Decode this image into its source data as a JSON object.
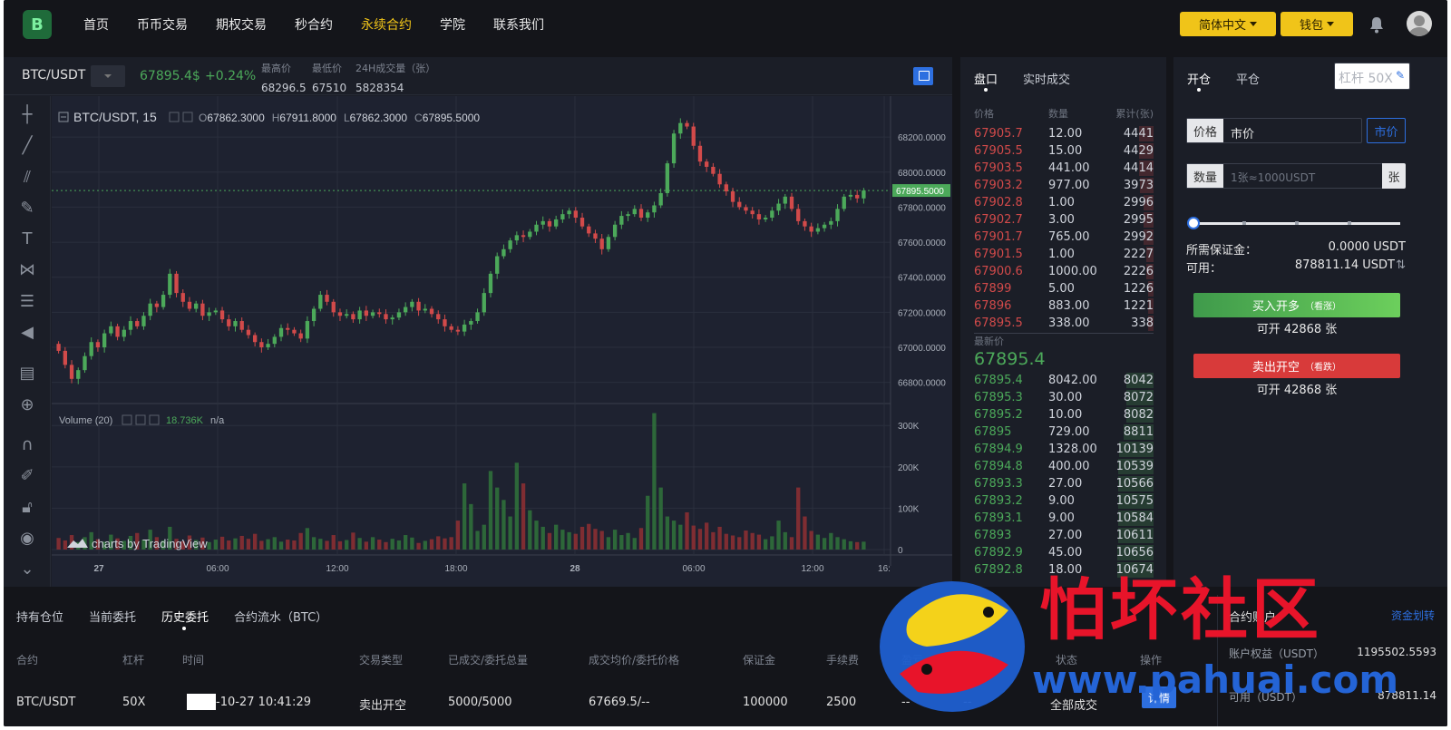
{
  "nav": {
    "logo": "B",
    "items": [
      "首页",
      "币币交易",
      "期权交易",
      "秒合约",
      "永续合约",
      "学院",
      "联系我们"
    ],
    "active_index": 4,
    "lang_label": "简体中文",
    "wallet_label": "钱包"
  },
  "ticker": {
    "pair": "BTC/USDT",
    "price": "67895.4$",
    "change": "+0.24%",
    "high_label": "最高价",
    "high": "68296.5",
    "low_label": "最低价",
    "low": "67510",
    "vol_label": "24H成交量（张）",
    "vol": "5828354"
  },
  "chart": {
    "legend_pair": "BTC/USDT, 15",
    "o": "67862.3000",
    "h": "67911.8000",
    "l": "67862.3000",
    "c": "67895.5000",
    "price_tag": "67895.5000",
    "volume_label": "Volume (20)",
    "volume_value": "18.736K",
    "volume_na": "n/a",
    "credit": "charts by TradingView",
    "y_ticks": [
      "68200.0000",
      "68000.0000",
      "67800.0000",
      "67600.0000",
      "67400.0000",
      "67200.0000",
      "67000.0000",
      "66800.0000"
    ],
    "vol_ticks": [
      "300K",
      "200K",
      "100K",
      "0"
    ],
    "x_ticks": [
      "27",
      "06:00",
      "12:00",
      "18:00",
      "28",
      "06:00",
      "12:00",
      "16:"
    ]
  },
  "chart_data": {
    "type": "candlestick",
    "y_range": [
      66700,
      68330
    ],
    "vol_range": [
      0,
      340000
    ],
    "closes": [
      66980,
      66900,
      66820,
      66870,
      66950,
      67030,
      67000,
      67080,
      67120,
      67060,
      67100,
      67150,
      67120,
      67180,
      67250,
      67230,
      67300,
      67420,
      67310,
      67260,
      67220,
      67250,
      67180,
      67200,
      67210,
      67160,
      67120,
      67150,
      67100,
      67070,
      67030,
      67000,
      67020,
      67060,
      67110,
      67100,
      67080,
      67050,
      67150,
      67220,
      67300,
      67260,
      67200,
      67180,
      67190,
      67160,
      67210,
      67180,
      67200,
      67190,
      67160,
      67170,
      67200,
      67230,
      67260,
      67210,
      67220,
      67190,
      67160,
      67120,
      67100,
      67090,
      67130,
      67150,
      67200,
      67310,
      67420,
      67520,
      67560,
      67610,
      67640,
      67630,
      67660,
      67700,
      67720,
      67690,
      67730,
      67760,
      67780,
      67740,
      67690,
      67650,
      67620,
      67560,
      67630,
      67700,
      67750,
      67760,
      67790,
      67740,
      67770,
      67810,
      67880,
      68050,
      68220,
      68280,
      68260,
      68150,
      68060,
      68030,
      67990,
      67930,
      67890,
      67830,
      67800,
      67780,
      67760,
      67730,
      67740,
      67780,
      67820,
      67860,
      67790,
      67720,
      67690,
      67660,
      67680,
      67700,
      67720,
      67790,
      67860,
      67870,
      67850,
      67895
    ],
    "volumes": [
      28000,
      22000,
      35000,
      18000,
      30000,
      42000,
      25000,
      19000,
      36000,
      27000,
      21000,
      33000,
      40000,
      24000,
      48000,
      30000,
      22000,
      55000,
      26000,
      20000,
      34000,
      23000,
      29000,
      18000,
      24000,
      31000,
      22000,
      27000,
      33000,
      26000,
      38000,
      21000,
      25000,
      30000,
      19000,
      24000,
      22000,
      40000,
      52000,
      30000,
      26000,
      21000,
      35000,
      20000,
      23000,
      41000,
      28000,
      19000,
      30000,
      24000,
      18000,
      26000,
      22000,
      35000,
      29000,
      16000,
      21000,
      25000,
      32000,
      27000,
      30000,
      70000,
      160000,
      110000,
      45000,
      60000,
      190000,
      150000,
      120000,
      80000,
      210000,
      160000,
      95000,
      70000,
      55000,
      40000,
      60000,
      48000,
      42000,
      38000,
      55000,
      62000,
      50000,
      45000,
      30000,
      48000,
      35000,
      40000,
      28000,
      52000,
      130000,
      330000,
      150000,
      80000,
      70000,
      60000,
      90000,
      58000,
      50000,
      65000,
      42000,
      55000,
      38000,
      34000,
      30000,
      46000,
      40000,
      36000,
      25000,
      32000,
      70000,
      42000,
      30000,
      150000,
      80000,
      45000,
      36000,
      28000,
      40000,
      30000,
      25000,
      20000,
      18000,
      19000,
      15000
    ]
  },
  "book": {
    "tab_book": "盘口",
    "tab_trades": "实时成交",
    "col_price": "价格",
    "col_qty": "数量",
    "col_total": "累计(张)",
    "asks": [
      [
        "67905.7",
        "12.00",
        "4441"
      ],
      [
        "67905.5",
        "15.00",
        "4429"
      ],
      [
        "67903.5",
        "441.00",
        "4414"
      ],
      [
        "67903.2",
        "977.00",
        "3973"
      ],
      [
        "67902.8",
        "1.00",
        "2996"
      ],
      [
        "67902.7",
        "3.00",
        "2995"
      ],
      [
        "67901.7",
        "765.00",
        "2992"
      ],
      [
        "67901.5",
        "1.00",
        "2227"
      ],
      [
        "67900.6",
        "1000.00",
        "2226"
      ],
      [
        "67899",
        "5.00",
        "1226"
      ],
      [
        "67896",
        "883.00",
        "1221"
      ],
      [
        "67895.5",
        "338.00",
        "338"
      ]
    ],
    "last_label": "最新价",
    "last_price": "67895.4",
    "bids": [
      [
        "67895.4",
        "8042.00",
        "8042"
      ],
      [
        "67895.3",
        "30.00",
        "8072"
      ],
      [
        "67895.2",
        "10.00",
        "8082"
      ],
      [
        "67895",
        "729.00",
        "8811"
      ],
      [
        "67894.9",
        "1328.00",
        "10139"
      ],
      [
        "67894.8",
        "400.00",
        "10539"
      ],
      [
        "67893.3",
        "27.00",
        "10566"
      ],
      [
        "67893.2",
        "9.00",
        "10575"
      ],
      [
        "67893.1",
        "9.00",
        "10584"
      ],
      [
        "67893",
        "27.00",
        "10611"
      ],
      [
        "67892.9",
        "45.00",
        "10656"
      ],
      [
        "67892.8",
        "18.00",
        "10674"
      ]
    ]
  },
  "trade": {
    "tab_open": "开仓",
    "tab_close": "平仓",
    "leverage": "杠杆 50X",
    "price_label": "价格",
    "price_value": "市价",
    "market_btn": "市价",
    "qty_label": "数量",
    "qty_placeholder": "1张≈1000USDT",
    "qty_unit": "张",
    "margin_label": "所需保证金：",
    "margin_value": "0.0000 USDT",
    "available_label": "可用：",
    "available_value": "878811.14 USDT",
    "buy_label": "买入开多",
    "buy_sub": "（看涨）",
    "buy_avail": "可开 42868 张",
    "sell_label": "卖出开空",
    "sell_sub": "（看跌）",
    "sell_avail": "可开 42868 张"
  },
  "orders": {
    "tabs": [
      "持有仓位",
      "当前委托",
      "历史委托",
      "合约流水（BTC）"
    ],
    "active_tab": 2,
    "headers": [
      "合约",
      "杠杆",
      "时间",
      "交易类型",
      "已成交/委托总量",
      "成交均价/委托价格",
      "保证金",
      "手续费",
      "盈亏",
      "单号",
      "状态",
      "操作"
    ],
    "row": {
      "contract": "BTC/USDT",
      "leverage": "50X",
      "time": "-10-27 10:41:29",
      "type": "卖出开空",
      "filled": "5000/5000",
      "avg_price": "67669.5/--",
      "margin": "100000",
      "fee": "2500",
      "pnl": "--",
      "order_no": "--",
      "status": "全部成交",
      "action": "详情"
    }
  },
  "account": {
    "title": "合约账户",
    "transfer": "资金划转",
    "equity_label": "账户权益（USDT）",
    "equity_value": "1195502.5593",
    "available_label": "可用（USDT）",
    "available_value": "878811.14"
  },
  "watermark": {
    "text": "怕坏社区",
    "url": "www.pahuai.com"
  }
}
